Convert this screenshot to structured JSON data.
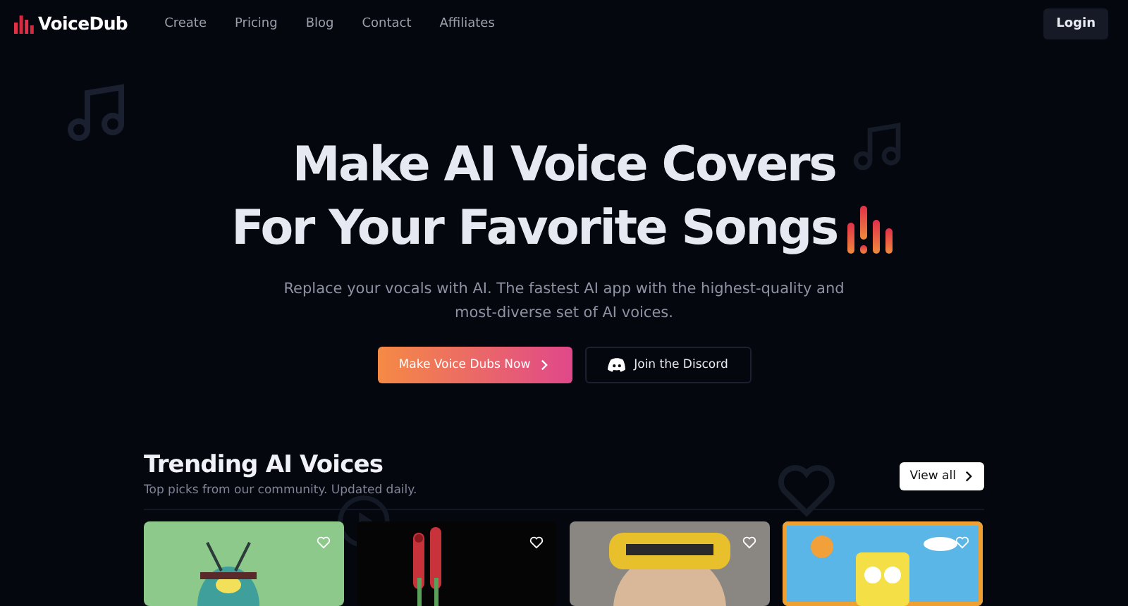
{
  "brand": "VoiceDub",
  "nav": [
    {
      "label": "Create"
    },
    {
      "label": "Pricing"
    },
    {
      "label": "Blog"
    },
    {
      "label": "Contact"
    },
    {
      "label": "Affiliates"
    }
  ],
  "login": "Login",
  "hero": {
    "title_lines": [
      "Make AI Voice Covers",
      "For Your Favorite Songs"
    ],
    "subtitle": "Replace your vocals with AI. The fastest AI app with the highest-quality and most-diverse set of AI voices.",
    "primary_button": "Make Voice Dubs Now",
    "secondary_button": "Join the Discord"
  },
  "trending": {
    "title": "Trending AI Voices",
    "subtitle": "Top picks from our community. Updated daily.",
    "view_all": "View all"
  }
}
